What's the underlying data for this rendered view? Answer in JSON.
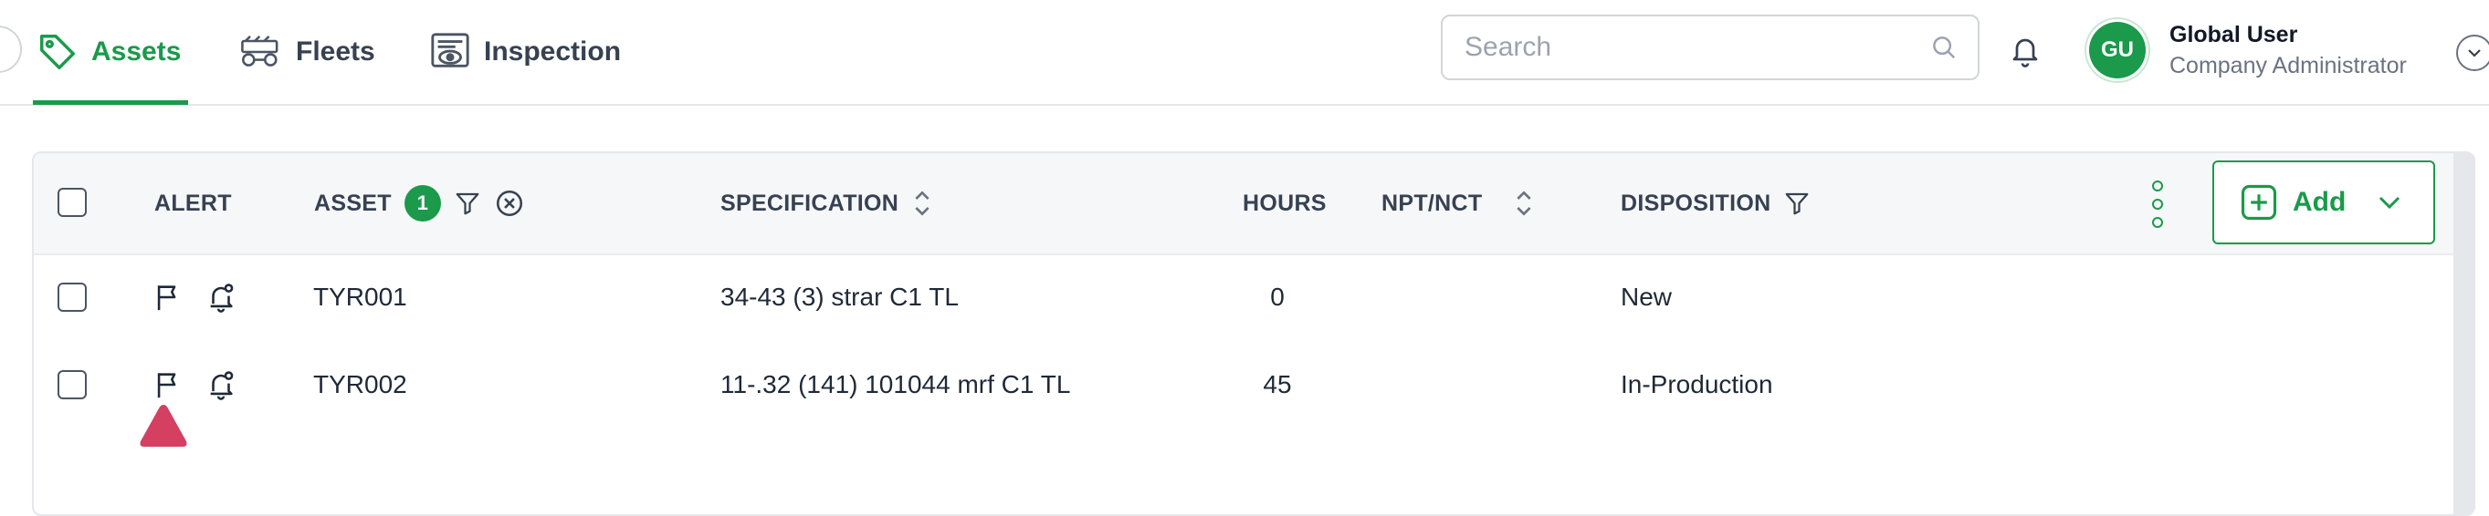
{
  "nav": {
    "tabs": [
      {
        "label": "Assets",
        "icon": "tag-icon",
        "active": true
      },
      {
        "label": "Fleets",
        "icon": "fleet-icon",
        "active": false
      },
      {
        "label": "Inspection",
        "icon": "inspection-icon",
        "active": false
      }
    ],
    "search_placeholder": "Search",
    "user": {
      "initials": "GU",
      "name": "Global User",
      "role": "Company Administrator"
    }
  },
  "colors": {
    "accent": "#1a9a4a",
    "alert": "#d43f62",
    "header_bg": "#f6f7f9"
  },
  "table": {
    "columns": {
      "alert": "ALERT",
      "asset": "ASSET",
      "asset_filter_count": "1",
      "specification": "SPECIFICATION",
      "hours": "HOURS",
      "npt_nct": "NPT/NCT",
      "disposition": "DISPOSITION"
    },
    "add_label": "Add",
    "rows": [
      {
        "asset": "TYR001",
        "specification": "34-43 (3) strar C1 TL",
        "hours": "0",
        "npt_nct": "",
        "disposition": "New"
      },
      {
        "asset": "TYR002",
        "specification": "11-.32 (141) 101044 mrf C1 TL",
        "hours": "45",
        "npt_nct": "",
        "disposition": "In-Production"
      }
    ]
  }
}
